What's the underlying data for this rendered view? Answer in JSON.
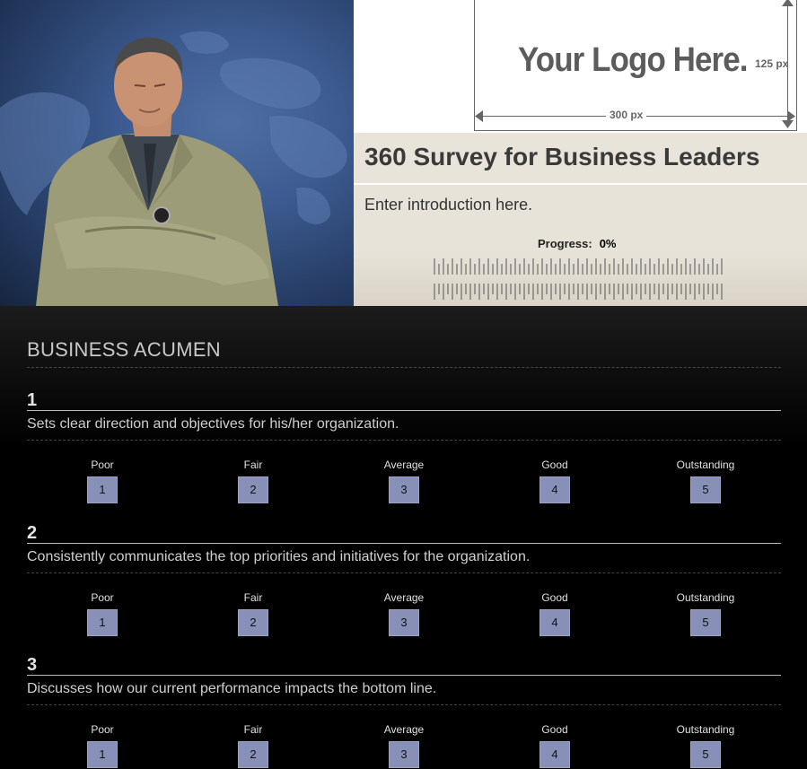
{
  "header": {
    "logo_text": "Your Logo Here.",
    "logo_height_label": "125 px",
    "logo_width_label": "300 px",
    "title": "360 Survey for Business Leaders",
    "intro": "Enter introduction here.",
    "progress_label": "Progress:",
    "progress_value": "0%"
  },
  "progress": {
    "fraction": 0
  },
  "section": {
    "title": "BUSINESS ACUMEN"
  },
  "questions": [
    {
      "number": "1",
      "text": "Sets clear direction and objectives for his/her organization.",
      "options": [
        {
          "label": "Poor",
          "value": "1"
        },
        {
          "label": "Fair",
          "value": "2"
        },
        {
          "label": "Average",
          "value": "3"
        },
        {
          "label": "Good",
          "value": "4"
        },
        {
          "label": "Outstanding",
          "value": "5"
        }
      ]
    },
    {
      "number": "2",
      "text": "Consistently communicates the top priorities and initiatives for the organization.",
      "options": [
        {
          "label": "Poor",
          "value": "1"
        },
        {
          "label": "Fair",
          "value": "2"
        },
        {
          "label": "Average",
          "value": "3"
        },
        {
          "label": "Good",
          "value": "4"
        },
        {
          "label": "Outstanding",
          "value": "5"
        }
      ]
    },
    {
      "number": "3",
      "text": "Discusses how our current performance impacts the bottom line.",
      "options": [
        {
          "label": "Poor",
          "value": "1"
        },
        {
          "label": "Fair",
          "value": "2"
        },
        {
          "label": "Average",
          "value": "3"
        },
        {
          "label": "Good",
          "value": "4"
        },
        {
          "label": "Outstanding",
          "value": "5"
        }
      ]
    }
  ],
  "colors": {
    "rating_button": "#8890b8",
    "title_bar": "#e8e4d9",
    "background": "#000000"
  }
}
